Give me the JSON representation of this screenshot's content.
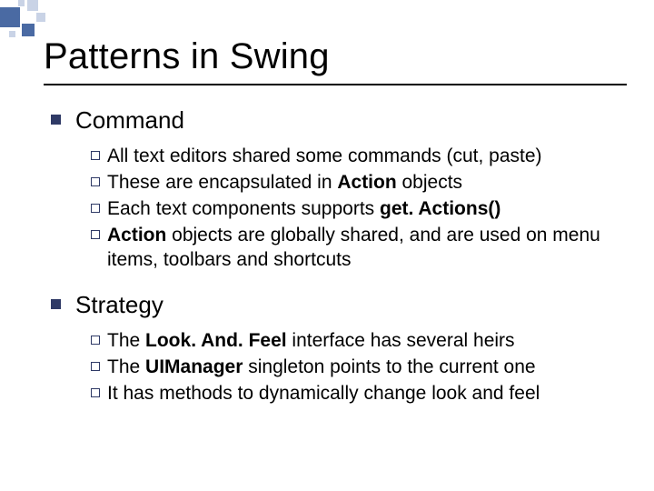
{
  "title": "Patterns in Swing",
  "sections": [
    {
      "heading": "Command",
      "items": [
        {
          "pre": "All text editors shared some commands (cut, paste)"
        },
        {
          "pre": "These are encapsulated in ",
          "bold1": "Action",
          "post1": " objects"
        },
        {
          "pre": "Each text components supports ",
          "bold1": "get. Actions()"
        },
        {
          "bold0": "Action",
          "post0": " objects are globally shared, and are used on menu items, toolbars and shortcuts"
        }
      ]
    },
    {
      "heading": "Strategy",
      "items": [
        {
          "pre": "The ",
          "bold1": "Look. And. Feel",
          "post1": " interface has several heirs"
        },
        {
          "pre": "The ",
          "bold1": "UIManager",
          "post1": " singleton points to the current one"
        },
        {
          "pre": "It has methods to dynamically change look and feel"
        }
      ]
    }
  ]
}
